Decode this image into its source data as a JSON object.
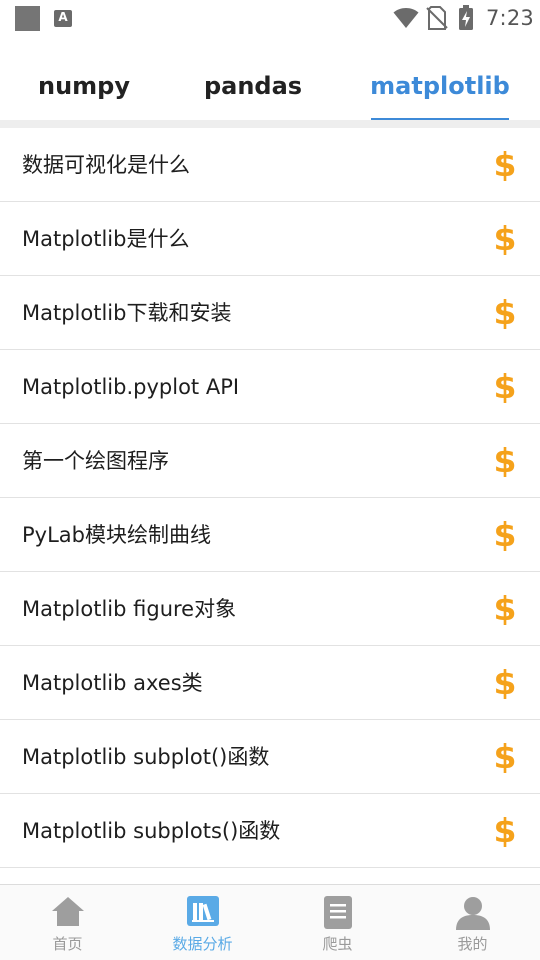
{
  "status_bar": {
    "notification_icon": "square-icon",
    "app_icon_letter": "A",
    "wifi_icon": "wifi-icon",
    "sim_icon": "no-sim-icon",
    "battery_icon": "battery-charging-icon",
    "time": "7:23"
  },
  "tabs": [
    {
      "label": "numpy",
      "active": false
    },
    {
      "label": "pandas",
      "active": false
    },
    {
      "label": "matplotlib",
      "active": true
    }
  ],
  "colors": {
    "accent": "#3d8ad8",
    "coin": "#f5a21b",
    "nav_active": "#5aaae6",
    "nav_inactive": "#9a9a9a"
  },
  "list": {
    "items": [
      {
        "label": "数据可视化是什么",
        "icon": "dollar-coin-icon"
      },
      {
        "label": "Matplotlib是什么",
        "icon": "dollar-coin-icon"
      },
      {
        "label": "Matplotlib下载和安装",
        "icon": "dollar-coin-icon"
      },
      {
        "label": "Matplotlib.pyplot API",
        "icon": "dollar-coin-icon"
      },
      {
        "label": "第一个绘图程序",
        "icon": "dollar-coin-icon"
      },
      {
        "label": "PyLab模块绘制曲线",
        "icon": "dollar-coin-icon"
      },
      {
        "label": "Matplotlib figure对象",
        "icon": "dollar-coin-icon"
      },
      {
        "label": "Matplotlib axes类",
        "icon": "dollar-coin-icon"
      },
      {
        "label": "Matplotlib subplot()函数",
        "icon": "dollar-coin-icon"
      },
      {
        "label": "Matplotlib subplots()函数",
        "icon": "dollar-coin-icon"
      }
    ]
  },
  "bottom_nav": [
    {
      "label": "首页",
      "icon": "home-icon",
      "active": false
    },
    {
      "label": "数据分析",
      "icon": "books-icon",
      "active": true
    },
    {
      "label": "爬虫",
      "icon": "document-icon",
      "active": false
    },
    {
      "label": "我的",
      "icon": "person-icon",
      "active": false
    }
  ]
}
